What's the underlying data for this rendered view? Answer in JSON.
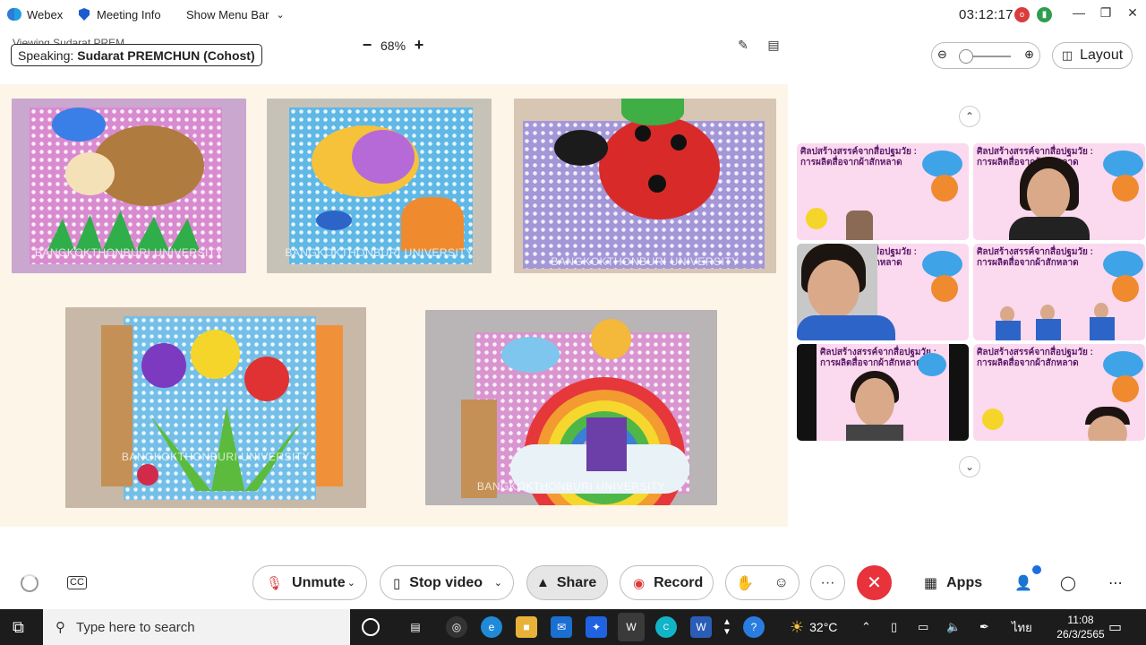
{
  "titlebar": {
    "app_name": "Webex",
    "meeting_info": "Meeting Info",
    "show_menu_bar": "Show Menu Bar",
    "timer": "03:12:17",
    "badge_recording": "o"
  },
  "share_header": {
    "viewing_behind": "Viewing Sudarat PREM",
    "speaking_label": "Speaking:",
    "speaking_name": "Sudarat PREMCHUN (Cohost)",
    "zoom_minus": "−",
    "zoom_level": "68%",
    "zoom_plus": "+"
  },
  "shared_content": {
    "watermarks": [
      "BANGKOKTHONBURI UNIVERSITY",
      "BANGKOKTHONBURI UNIVERSITY",
      "BANGKOKTHONBURI UNIVERSITY",
      "BANGKOKTHONBURI UNIVERSITY",
      "BANGKOKTHONBURI UNIVERSITY"
    ]
  },
  "right_panel": {
    "layout_label": "Layout",
    "tile_title": "ศิลปสร้างสรรค์จากสื่อปฐมวัย : การผลิตสื่อจากผ้าสักหลาด"
  },
  "controls": {
    "unmute": "Unmute",
    "stop_video": "Stop video",
    "share": "Share",
    "record": "Record",
    "more": "···",
    "apps": "Apps"
  },
  "taskbar": {
    "search_placeholder": "Type here to search",
    "temperature": "32°C",
    "language": "ไทย",
    "time": "11:08",
    "date": "26/3/2565"
  },
  "colors": {
    "end_call": "#e8323c",
    "webex_blue": "#1b5ccf",
    "taskbar": "#1c1c1c"
  }
}
